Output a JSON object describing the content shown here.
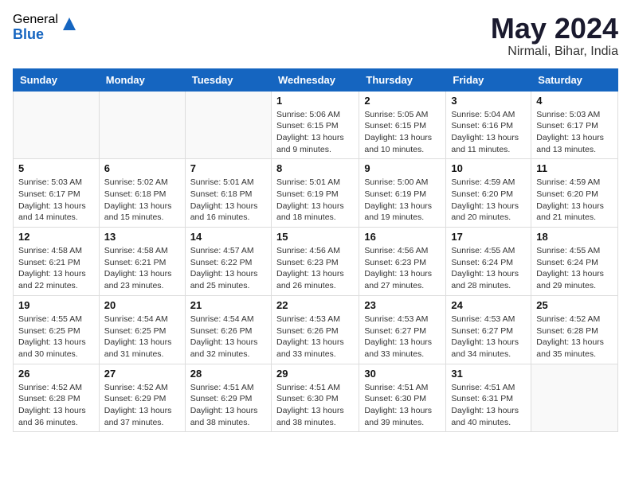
{
  "header": {
    "logo_general": "General",
    "logo_blue": "Blue",
    "month_title": "May 2024",
    "location": "Nirmali, Bihar, India"
  },
  "weekdays": [
    "Sunday",
    "Monday",
    "Tuesday",
    "Wednesday",
    "Thursday",
    "Friday",
    "Saturday"
  ],
  "weeks": [
    [
      {
        "day": "",
        "info": ""
      },
      {
        "day": "",
        "info": ""
      },
      {
        "day": "",
        "info": ""
      },
      {
        "day": "1",
        "info": "Sunrise: 5:06 AM\nSunset: 6:15 PM\nDaylight: 13 hours\nand 9 minutes."
      },
      {
        "day": "2",
        "info": "Sunrise: 5:05 AM\nSunset: 6:15 PM\nDaylight: 13 hours\nand 10 minutes."
      },
      {
        "day": "3",
        "info": "Sunrise: 5:04 AM\nSunset: 6:16 PM\nDaylight: 13 hours\nand 11 minutes."
      },
      {
        "day": "4",
        "info": "Sunrise: 5:03 AM\nSunset: 6:17 PM\nDaylight: 13 hours\nand 13 minutes."
      }
    ],
    [
      {
        "day": "5",
        "info": "Sunrise: 5:03 AM\nSunset: 6:17 PM\nDaylight: 13 hours\nand 14 minutes."
      },
      {
        "day": "6",
        "info": "Sunrise: 5:02 AM\nSunset: 6:18 PM\nDaylight: 13 hours\nand 15 minutes."
      },
      {
        "day": "7",
        "info": "Sunrise: 5:01 AM\nSunset: 6:18 PM\nDaylight: 13 hours\nand 16 minutes."
      },
      {
        "day": "8",
        "info": "Sunrise: 5:01 AM\nSunset: 6:19 PM\nDaylight: 13 hours\nand 18 minutes."
      },
      {
        "day": "9",
        "info": "Sunrise: 5:00 AM\nSunset: 6:19 PM\nDaylight: 13 hours\nand 19 minutes."
      },
      {
        "day": "10",
        "info": "Sunrise: 4:59 AM\nSunset: 6:20 PM\nDaylight: 13 hours\nand 20 minutes."
      },
      {
        "day": "11",
        "info": "Sunrise: 4:59 AM\nSunset: 6:20 PM\nDaylight: 13 hours\nand 21 minutes."
      }
    ],
    [
      {
        "day": "12",
        "info": "Sunrise: 4:58 AM\nSunset: 6:21 PM\nDaylight: 13 hours\nand 22 minutes."
      },
      {
        "day": "13",
        "info": "Sunrise: 4:58 AM\nSunset: 6:21 PM\nDaylight: 13 hours\nand 23 minutes."
      },
      {
        "day": "14",
        "info": "Sunrise: 4:57 AM\nSunset: 6:22 PM\nDaylight: 13 hours\nand 25 minutes."
      },
      {
        "day": "15",
        "info": "Sunrise: 4:56 AM\nSunset: 6:23 PM\nDaylight: 13 hours\nand 26 minutes."
      },
      {
        "day": "16",
        "info": "Sunrise: 4:56 AM\nSunset: 6:23 PM\nDaylight: 13 hours\nand 27 minutes."
      },
      {
        "day": "17",
        "info": "Sunrise: 4:55 AM\nSunset: 6:24 PM\nDaylight: 13 hours\nand 28 minutes."
      },
      {
        "day": "18",
        "info": "Sunrise: 4:55 AM\nSunset: 6:24 PM\nDaylight: 13 hours\nand 29 minutes."
      }
    ],
    [
      {
        "day": "19",
        "info": "Sunrise: 4:55 AM\nSunset: 6:25 PM\nDaylight: 13 hours\nand 30 minutes."
      },
      {
        "day": "20",
        "info": "Sunrise: 4:54 AM\nSunset: 6:25 PM\nDaylight: 13 hours\nand 31 minutes."
      },
      {
        "day": "21",
        "info": "Sunrise: 4:54 AM\nSunset: 6:26 PM\nDaylight: 13 hours\nand 32 minutes."
      },
      {
        "day": "22",
        "info": "Sunrise: 4:53 AM\nSunset: 6:26 PM\nDaylight: 13 hours\nand 33 minutes."
      },
      {
        "day": "23",
        "info": "Sunrise: 4:53 AM\nSunset: 6:27 PM\nDaylight: 13 hours\nand 33 minutes."
      },
      {
        "day": "24",
        "info": "Sunrise: 4:53 AM\nSunset: 6:27 PM\nDaylight: 13 hours\nand 34 minutes."
      },
      {
        "day": "25",
        "info": "Sunrise: 4:52 AM\nSunset: 6:28 PM\nDaylight: 13 hours\nand 35 minutes."
      }
    ],
    [
      {
        "day": "26",
        "info": "Sunrise: 4:52 AM\nSunset: 6:28 PM\nDaylight: 13 hours\nand 36 minutes."
      },
      {
        "day": "27",
        "info": "Sunrise: 4:52 AM\nSunset: 6:29 PM\nDaylight: 13 hours\nand 37 minutes."
      },
      {
        "day": "28",
        "info": "Sunrise: 4:51 AM\nSunset: 6:29 PM\nDaylight: 13 hours\nand 38 minutes."
      },
      {
        "day": "29",
        "info": "Sunrise: 4:51 AM\nSunset: 6:30 PM\nDaylight: 13 hours\nand 38 minutes."
      },
      {
        "day": "30",
        "info": "Sunrise: 4:51 AM\nSunset: 6:30 PM\nDaylight: 13 hours\nand 39 minutes."
      },
      {
        "day": "31",
        "info": "Sunrise: 4:51 AM\nSunset: 6:31 PM\nDaylight: 13 hours\nand 40 minutes."
      },
      {
        "day": "",
        "info": ""
      }
    ]
  ]
}
